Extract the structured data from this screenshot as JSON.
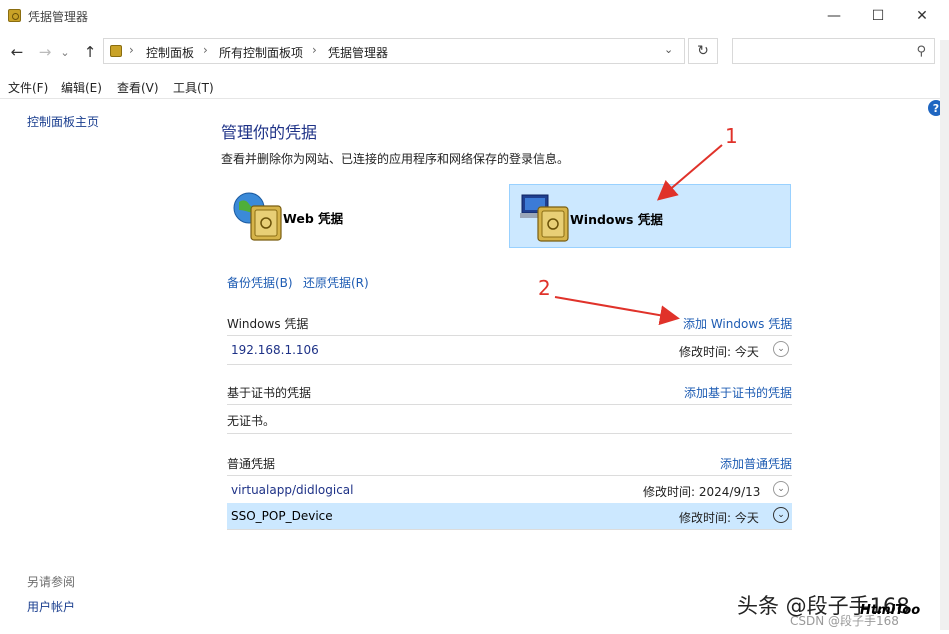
{
  "window": {
    "title": "凭据管理器",
    "min_glyph": "—",
    "max_glyph": "☐",
    "close_glyph": "✕"
  },
  "nav": {
    "back_glyph": "←",
    "forward_glyph": "→",
    "recent_glyph": "⌄",
    "up_glyph": "↑",
    "breadcrumbs": [
      "控制面板",
      "所有控制面板项",
      "凭据管理器"
    ],
    "crumb_sep": "›",
    "dropdown_glyph": "⌄",
    "refresh_glyph": "↻",
    "search_placeholder": "",
    "search_glyph": "⚲"
  },
  "menu": [
    "文件(F)",
    "编辑(E)",
    "查看(V)",
    "工具(T)"
  ],
  "sidebar": {
    "home": "控制面板主页",
    "see_also_head": "另请参阅",
    "user_accounts": "用户帐户"
  },
  "main": {
    "title": "管理你的凭据",
    "description": "查看并删除你为网站、已连接的应用程序和网络保存的登录信息。",
    "cards": {
      "web": "Web 凭据",
      "windows": "Windows 凭据"
    },
    "backup": "备份凭据(B)",
    "restore": "还原凭据(R)",
    "windows_section": {
      "heading": "Windows 凭据",
      "add_link": "添加 Windows 凭据",
      "items": [
        {
          "name": "192.168.1.106",
          "modified": "修改时间:  今天"
        }
      ]
    },
    "cert_section": {
      "heading": "基于证书的凭据",
      "add_link": "添加基于证书的凭据",
      "empty": "无证书。"
    },
    "generic_section": {
      "heading": "普通凭据",
      "add_link": "添加普通凭据",
      "items": [
        {
          "name": "virtualapp/didlogical",
          "modified": "修改时间:  2024/9/13"
        },
        {
          "name": "SSO_POP_Device",
          "modified": "修改时间:  今天"
        }
      ]
    }
  },
  "annotations": {
    "one": "1",
    "two": "2"
  },
  "help_glyph": "?",
  "chevron_glyph": "⌄",
  "watermark": {
    "text": "头条 @段子手168",
    "logo": "HtmlToo",
    "csdn": "CSDN @段子手168"
  },
  "colors": {
    "title_blue": "#1e3287",
    "link_blue": "#1e5cb3",
    "selected_bg": "#cce8ff",
    "annotation_red": "#e0322a"
  }
}
